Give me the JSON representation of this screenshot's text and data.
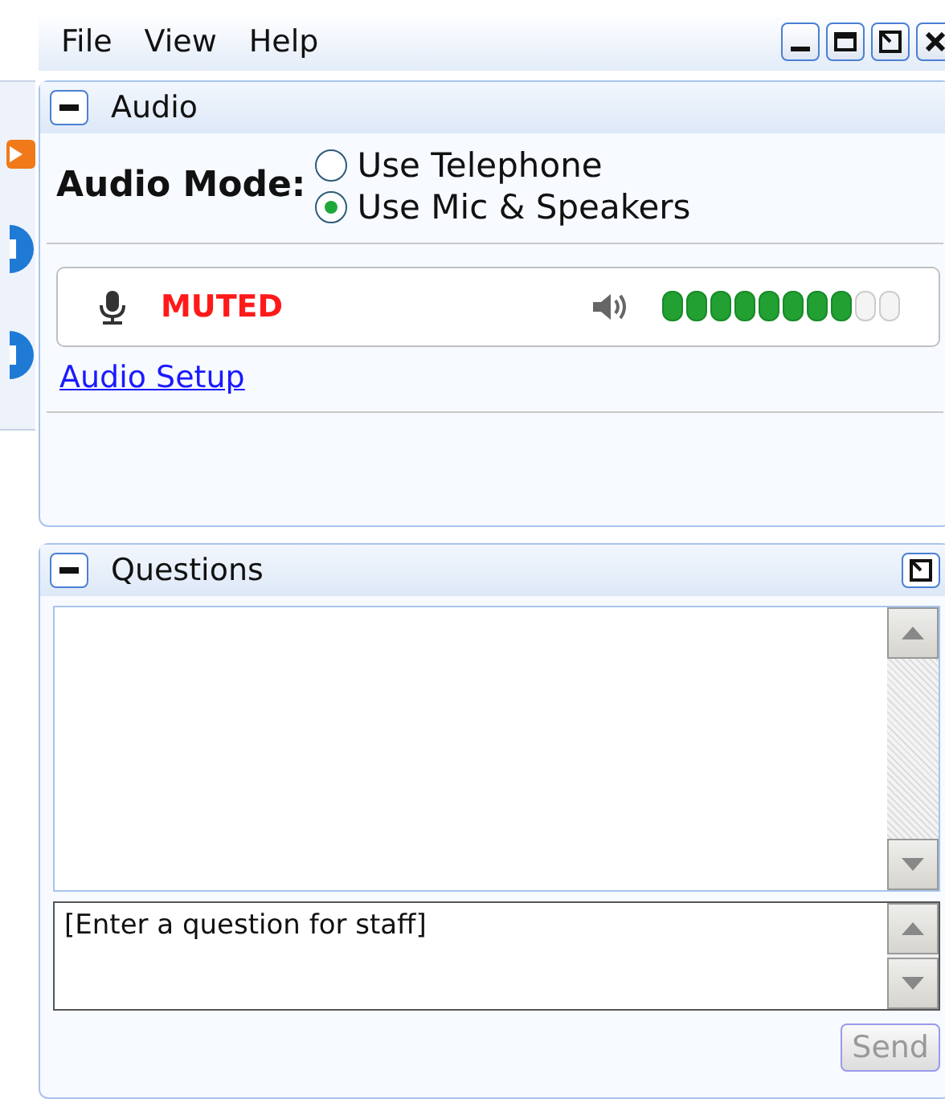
{
  "menu": [
    "File",
    "View",
    "Help"
  ],
  "audio": {
    "title": "Audio",
    "mode_label": "Audio Mode:",
    "options": [
      {
        "label": "Use Telephone",
        "selected": false
      },
      {
        "label": "Use Mic & Speakers",
        "selected": true
      }
    ],
    "mic_status": "MUTED",
    "speaker_meter": {
      "level": 0.8
    },
    "setup_link": "Audio Setup"
  },
  "questions": {
    "title": "Questions",
    "input": {
      "placeholder": "[Enter a question for staff]"
    },
    "send": {
      "label": "Send",
      "disabled": true
    }
  }
}
